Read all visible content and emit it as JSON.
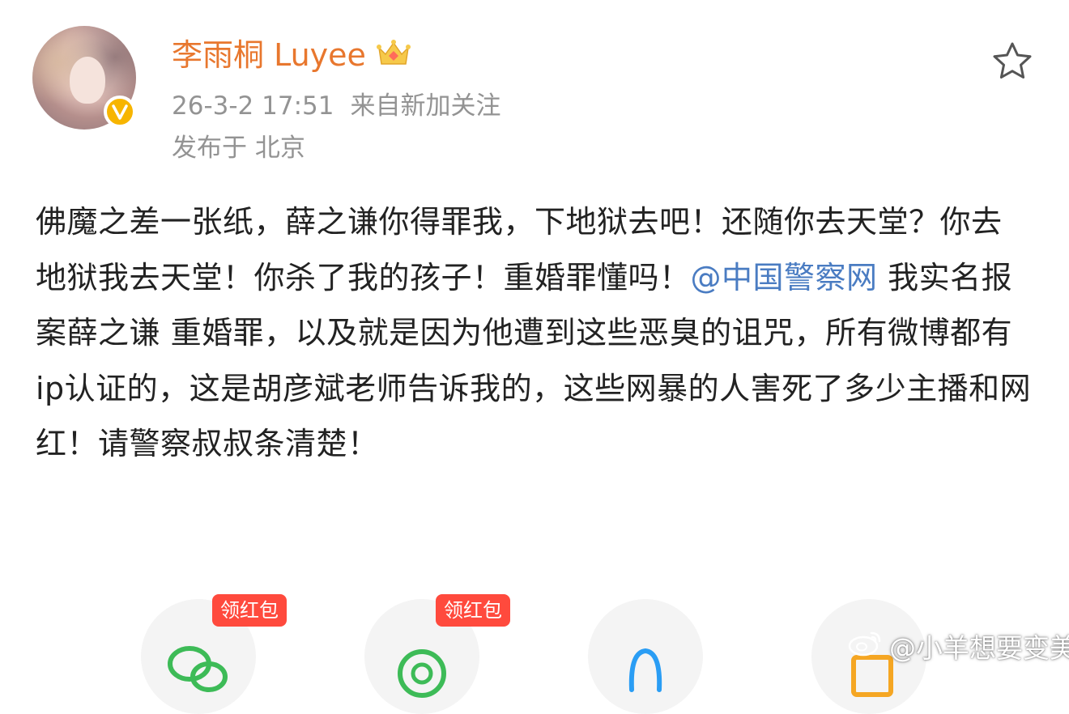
{
  "author": {
    "name": "李雨桐 Luyee",
    "verified_badge": "v",
    "crown_icon": "crown-icon"
  },
  "meta": {
    "timestamp": "26-3-2 17:51",
    "source": "来自新加关注",
    "location": "发布于 北京"
  },
  "post": {
    "text_before": "佛魔之差一张纸，薛之谦你得罪我，下地狱去吧！还随你去天堂？你去地狱我去天堂！你杀了我的孩子！重婚罪懂吗！",
    "mention": "@中国警察网",
    "text_after": " 我实名报案薛之谦 重婚罪，以及就是因为他遭到这些恶臭的诅咒，所有微博都有ip认证的，这是胡彦斌老师告诉我的，这些网暴的人害死了多少主播和网红！请警察叔叔条清楚！"
  },
  "share": {
    "items": [
      {
        "icon": "wechat-icon",
        "tag": "领红包",
        "color": "#3dbb57"
      },
      {
        "icon": "moments-icon",
        "tag": "领红包",
        "color": "#3dbb57"
      },
      {
        "icon": "qq-icon",
        "tag": "",
        "color": "#2a9df4"
      },
      {
        "icon": "qzone-icon",
        "tag": "",
        "color": "#f5a623"
      }
    ]
  },
  "favorite": {
    "icon": "star-icon"
  },
  "watermark": {
    "text": "@小羊想要变美",
    "icon": "weibo-icon"
  },
  "colors": {
    "username": "#e8772e",
    "meta": "#939393",
    "mention": "#4a7cc2",
    "tag": "#ff4a3d",
    "badge": "#f7b500"
  }
}
